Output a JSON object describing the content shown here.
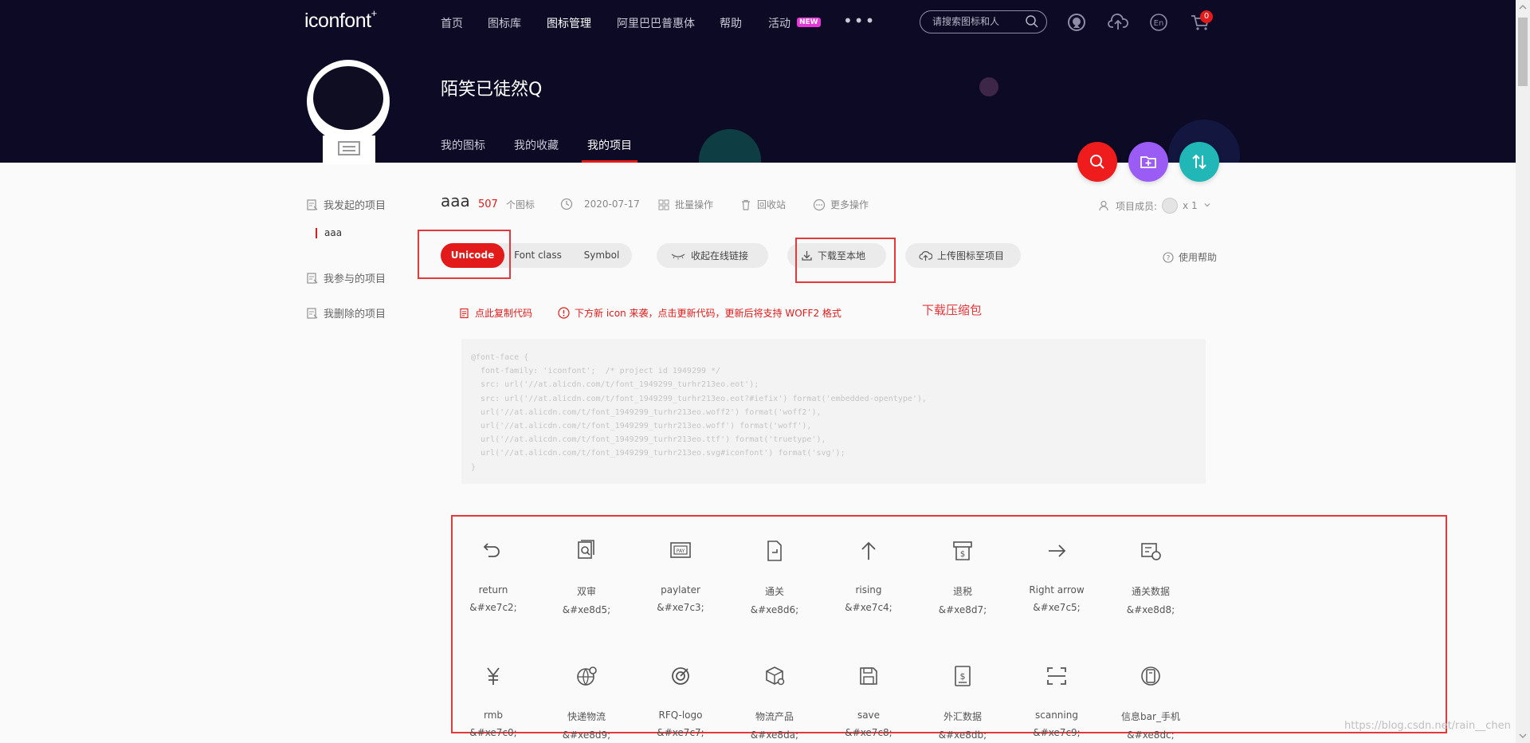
{
  "header": {
    "logo_text": "iconfont",
    "logo_mark": "+",
    "nav": [
      "首页",
      "图标库",
      "图标管理",
      "阿里巴巴普惠体",
      "帮助",
      "活动"
    ],
    "new_badge": "NEW",
    "more": "•••",
    "search_placeholder": "请搜索图标和人",
    "cart_count": "0"
  },
  "profile": {
    "name": "陌笑已徒然Q",
    "tabs": [
      "我的图标",
      "我的收藏",
      "我的项目"
    ]
  },
  "sidebar": {
    "started_projects": "我发起的项目",
    "project_item": "aaa",
    "joined_projects": "我参与的项目",
    "deleted_projects": "我删除的项目"
  },
  "project": {
    "name": "aaa",
    "count": "507",
    "count_unit": "个图标",
    "date": "2020-07-17",
    "batch_ops": "批量操作",
    "recycle": "回收站",
    "more_ops": "更多操作",
    "members_label": "项目成员:",
    "members_count": "x 1"
  },
  "toolbar": {
    "unicode": "Unicode",
    "font_class": "Font class",
    "symbol": "Symbol",
    "collapse_link": "收起在线链接",
    "download": "下载至本地",
    "upload": "上传图标至项目",
    "help": "使用帮助"
  },
  "notices": {
    "copy_code": "点此复制代码",
    "update": "下方新 icon 来袭，点击更新代码，更新后将支持 WOFF2 格式",
    "annotation": "下载压缩包"
  },
  "code": "@font-face {\n  font-family: 'iconfont';  /* project id 1949299 */\n  src: url('//at.alicdn.com/t/font_1949299_turhr213eo.eot');\n  src: url('//at.alicdn.com/t/font_1949299_turhr213eo.eot?#iefix') format('embedded-opentype'),\n  url('//at.alicdn.com/t/font_1949299_turhr213eo.woff2') format('woff2'),\n  url('//at.alicdn.com/t/font_1949299_turhr213eo.woff') format('woff'),\n  url('//at.alicdn.com/t/font_1949299_turhr213eo.ttf') format('truetype'),\n  url('//at.alicdn.com/t/font_1949299_turhr213eo.svg#iconfont') format('svg');\n}",
  "icons": [
    {
      "name": "return",
      "code": "&#xe7c2;",
      "glyph": "return-icon"
    },
    {
      "name": "双审",
      "code": "&#xe8d5;",
      "glyph": "double-review-icon"
    },
    {
      "name": "paylater",
      "code": "&#xe7c3;",
      "glyph": "paylater-icon"
    },
    {
      "name": "通关",
      "code": "&#xe8d6;",
      "glyph": "customs-clearance-icon"
    },
    {
      "name": "rising",
      "code": "&#xe7c4;",
      "glyph": "rising-arrow-icon"
    },
    {
      "name": "退税",
      "code": "&#xe8d7;",
      "glyph": "tax-refund-icon"
    },
    {
      "name": "Right arrow",
      "code": "&#xe7c5;",
      "glyph": "right-arrow-icon"
    },
    {
      "name": "通关数据",
      "code": "&#xe8d8;",
      "glyph": "customs-data-icon"
    },
    {
      "name": "rmb",
      "code": "&#xe7c0;",
      "glyph": "rmb-icon"
    },
    {
      "name": "快递物流",
      "code": "&#xe8d9;",
      "glyph": "express-logistics-icon"
    },
    {
      "name": "RFQ-logo",
      "code": "&#xe7c7;",
      "glyph": "rfq-logo-icon"
    },
    {
      "name": "物流产品",
      "code": "&#xe8da;",
      "glyph": "logistics-product-icon"
    },
    {
      "name": "save",
      "code": "&#xe7c8;",
      "glyph": "save-icon"
    },
    {
      "name": "外汇数据",
      "code": "&#xe8db;",
      "glyph": "forex-data-icon"
    },
    {
      "name": "scanning",
      "code": "&#xe7c9;",
      "glyph": "scanning-icon"
    },
    {
      "name": "信息bar_手机",
      "code": "&#xe8dc;",
      "glyph": "mobile-info-icon"
    }
  ],
  "watermark": "https://blog.csdn.net/rain__chen",
  "colors": {
    "header_bg": "#0c0a24",
    "accent_red": "#e31a1a",
    "fab_red": "#ee1c1c",
    "fab_purple": "#9b5cf5",
    "fab_teal": "#21b7b7",
    "annotation_red": "#e5383b"
  }
}
